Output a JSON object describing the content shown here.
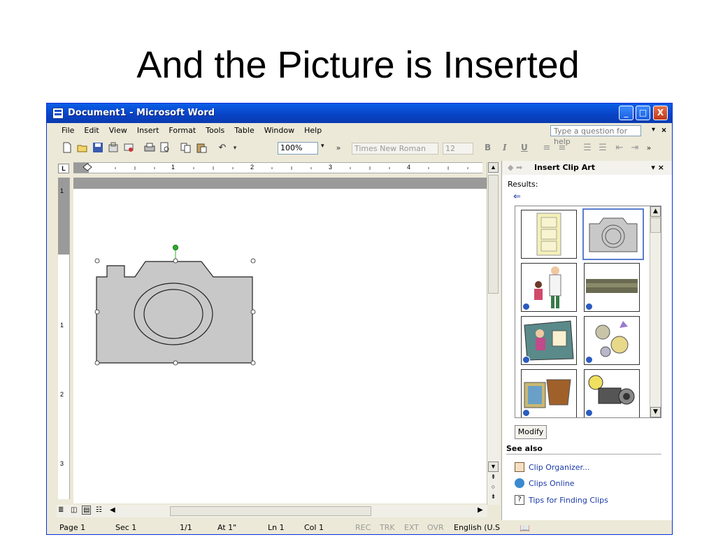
{
  "slide": {
    "title": "And the Picture is Inserted"
  },
  "window": {
    "title": "Document1 - Microsoft Word",
    "minimize": "_",
    "maximize": "□",
    "close": "X"
  },
  "menu": [
    "File",
    "Edit",
    "View",
    "Insert",
    "Format",
    "Tools",
    "Table",
    "Window",
    "Help"
  ],
  "help_box": {
    "placeholder": "Type a question for help"
  },
  "toolbar": {
    "zoom": "100%",
    "font": "Times New Roman",
    "size": "12",
    "bold": "B",
    "italic": "I",
    "underline": "U"
  },
  "ruler": {
    "h_numbers": [
      "1",
      "2",
      "3",
      "4"
    ],
    "v_numbers": [
      "1",
      "1",
      "2",
      "3"
    ],
    "corner": "L"
  },
  "task_pane": {
    "title": "Insert Clip Art",
    "results_label": "Results:",
    "modify": "Modify",
    "see_also": "See also",
    "links": [
      "Clip Organizer...",
      "Clips Online",
      "Tips for Finding Clips"
    ]
  },
  "status": {
    "page": "Page 1",
    "sec": "Sec 1",
    "pages": "1/1",
    "at": "At 1\"",
    "ln": "Ln 1",
    "col": "Col 1",
    "rec": "REC",
    "trk": "TRK",
    "ext": "EXT",
    "ovr": "OVR",
    "lang": "English (U.S"
  },
  "colors": {
    "titlebar": "#0842c4",
    "window": "#ece9d8",
    "camera": "#c8c8c8",
    "handle_green": "#2ab02a",
    "link": "#1a3aa8"
  }
}
